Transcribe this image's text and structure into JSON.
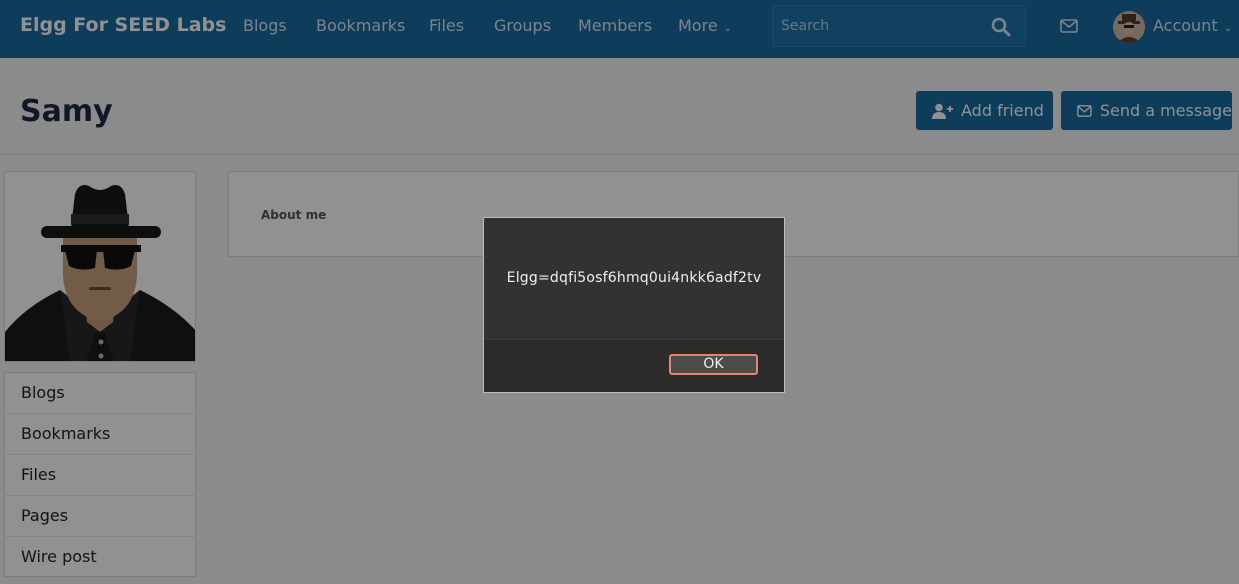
{
  "header": {
    "brand": "Elgg For SEED Labs",
    "nav": [
      "Blogs",
      "Bookmarks",
      "Files",
      "Groups",
      "Members",
      "More"
    ],
    "search": {
      "placeholder": "Search"
    },
    "account_label": "Account",
    "icons": {
      "search": "search-icon",
      "messages": "envelope-icon",
      "more": "chevron-down-icon"
    }
  },
  "profile": {
    "title": "Samy",
    "actions": {
      "add_friend": "Add friend",
      "send_message": "Send a message"
    },
    "about_label": "About me"
  },
  "owner_menu": [
    "Blogs",
    "Bookmarks",
    "Files",
    "Pages",
    "Wire post"
  ],
  "dialog": {
    "message": "Elgg=dqfi5osf6hmq0ui4nkk6adf2tv",
    "ok_label": "OK"
  },
  "colors": {
    "topbar": "#1a6aa0",
    "button": "#1a6aa0",
    "dialog_bg": "#323232",
    "ok_border": "#e2866f"
  }
}
